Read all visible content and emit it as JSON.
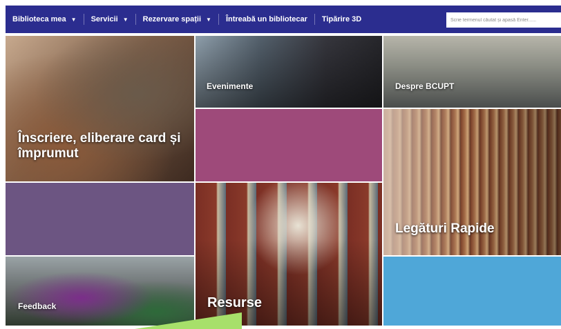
{
  "nav": {
    "items": [
      {
        "label": "Biblioteca mea",
        "caret": "▼"
      },
      {
        "label": "Servicii",
        "caret": "▼"
      },
      {
        "label": "Rezervare spații",
        "caret": "▼"
      },
      {
        "label": "Întreabă un bibliotecar",
        "caret": ""
      },
      {
        "label": "Tipărire 3D",
        "caret": ""
      }
    ],
    "search_placeholder": "Scrie termenul căutat și apasă Enter......"
  },
  "tiles": {
    "inscriere": "Înscriere, eliberare card și împrumut",
    "evenimente": "Evenimente",
    "despre": "Despre BCUPT",
    "legaturi": "Legături Rapide",
    "resurse": "Resurse",
    "feedback": "Feedback"
  },
  "colors": {
    "nav_bg": "#2b2d8f",
    "tile_magenta": "#9e4a7a",
    "tile_purple": "#6c5582",
    "tile_blue": "#4fa7d8",
    "arrow_green": "#a7e06a"
  }
}
